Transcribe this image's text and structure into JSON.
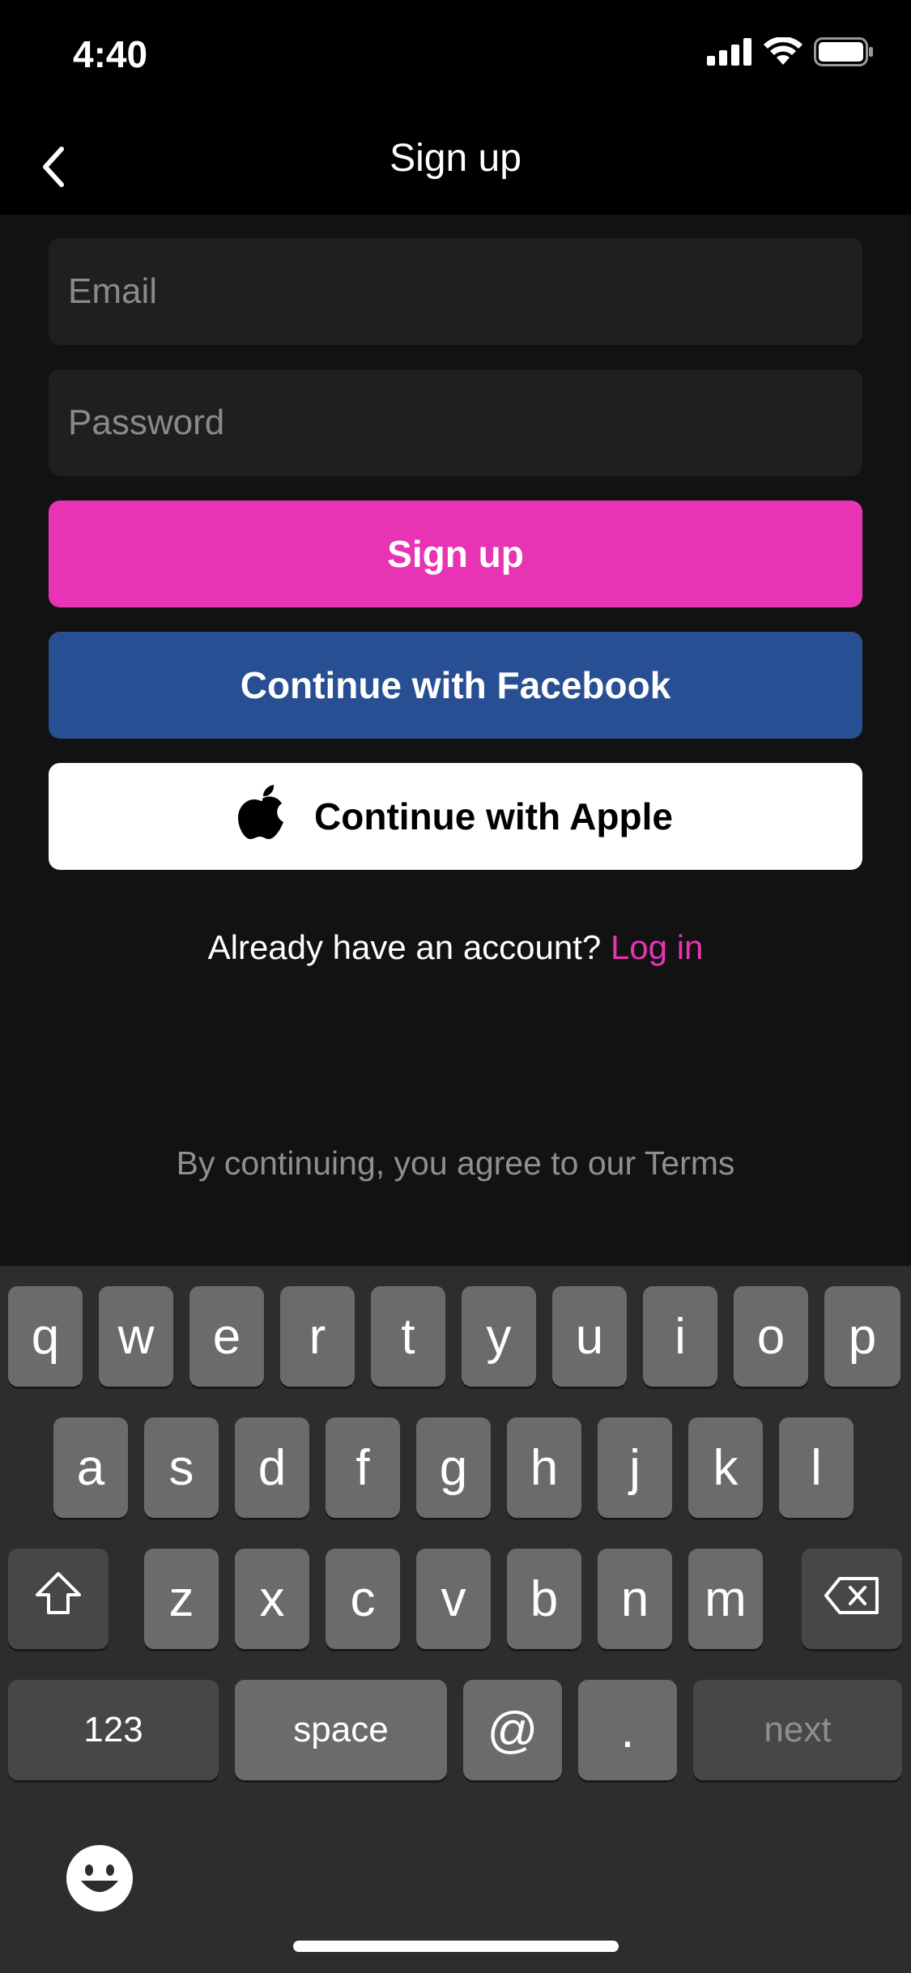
{
  "status_bar": {
    "time": "4:40"
  },
  "nav": {
    "title": "Sign up"
  },
  "form": {
    "email_placeholder": "Email",
    "email_value": "",
    "password_placeholder": "Password",
    "password_value": "",
    "signup_label": "Sign up",
    "facebook_label": "Continue with Facebook",
    "apple_label": "Continue with Apple"
  },
  "login_prompt": {
    "text": "Already have an account?",
    "link": "Log in"
  },
  "terms_text": "By continuing, you agree to our Terms",
  "keyboard": {
    "row1": [
      "q",
      "w",
      "e",
      "r",
      "t",
      "y",
      "u",
      "i",
      "o",
      "p"
    ],
    "row2": [
      "a",
      "s",
      "d",
      "f",
      "g",
      "h",
      "j",
      "k",
      "l"
    ],
    "row3": [
      "z",
      "x",
      "c",
      "v",
      "b",
      "n",
      "m"
    ],
    "numbers_label": "123",
    "space_label": "space",
    "at_label": "@",
    "dot_label": ".",
    "next_label": "next"
  },
  "colors": {
    "accent_pink": "#e834b4",
    "facebook_blue": "#284f93",
    "background": "#121212"
  },
  "icons": [
    "chevron-left-icon",
    "signal-icon",
    "wifi-icon",
    "battery-icon",
    "apple-logo-icon",
    "shift-icon",
    "delete-icon",
    "emoji-icon"
  ]
}
